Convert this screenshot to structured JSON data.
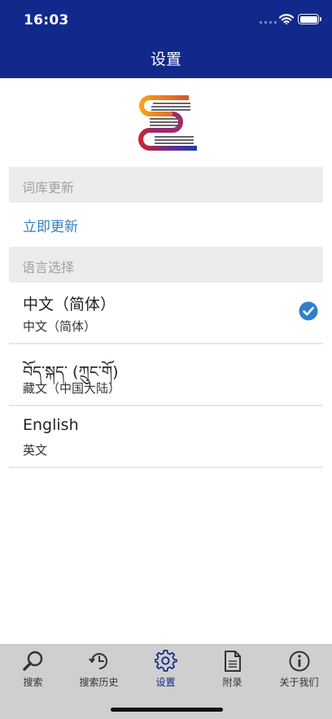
{
  "status_bar": {
    "time": "16:03"
  },
  "nav": {
    "title": "设置"
  },
  "sections": {
    "dictionary_update": {
      "header": "词库更新",
      "action": "立即更新"
    },
    "language": {
      "header": "语言选择"
    }
  },
  "languages": [
    {
      "title": "中文（简体）",
      "subtitle": "中文（简体）",
      "selected": true
    },
    {
      "title": "བོད་སྐད་ (ཀྲུང་གོ)",
      "subtitle": "藏文（中国大陆）",
      "selected": false
    },
    {
      "title": "English",
      "subtitle": "英文",
      "selected": false
    }
  ],
  "tab_bar": {
    "active": "设置",
    "tabs": [
      {
        "label": "搜索",
        "icon": "search-icon"
      },
      {
        "label": "搜索历史",
        "icon": "history-icon"
      },
      {
        "label": "设置",
        "icon": "gear-icon"
      },
      {
        "label": "附录",
        "icon": "document-icon"
      },
      {
        "label": "关于我们",
        "icon": "info-icon"
      }
    ]
  },
  "colors": {
    "nav_bar": "#12298c",
    "link": "#2f80c8",
    "check": "#2f80c8",
    "tab_bar_bg": "#cfcfcf",
    "section_header_bg": "#ececec"
  }
}
